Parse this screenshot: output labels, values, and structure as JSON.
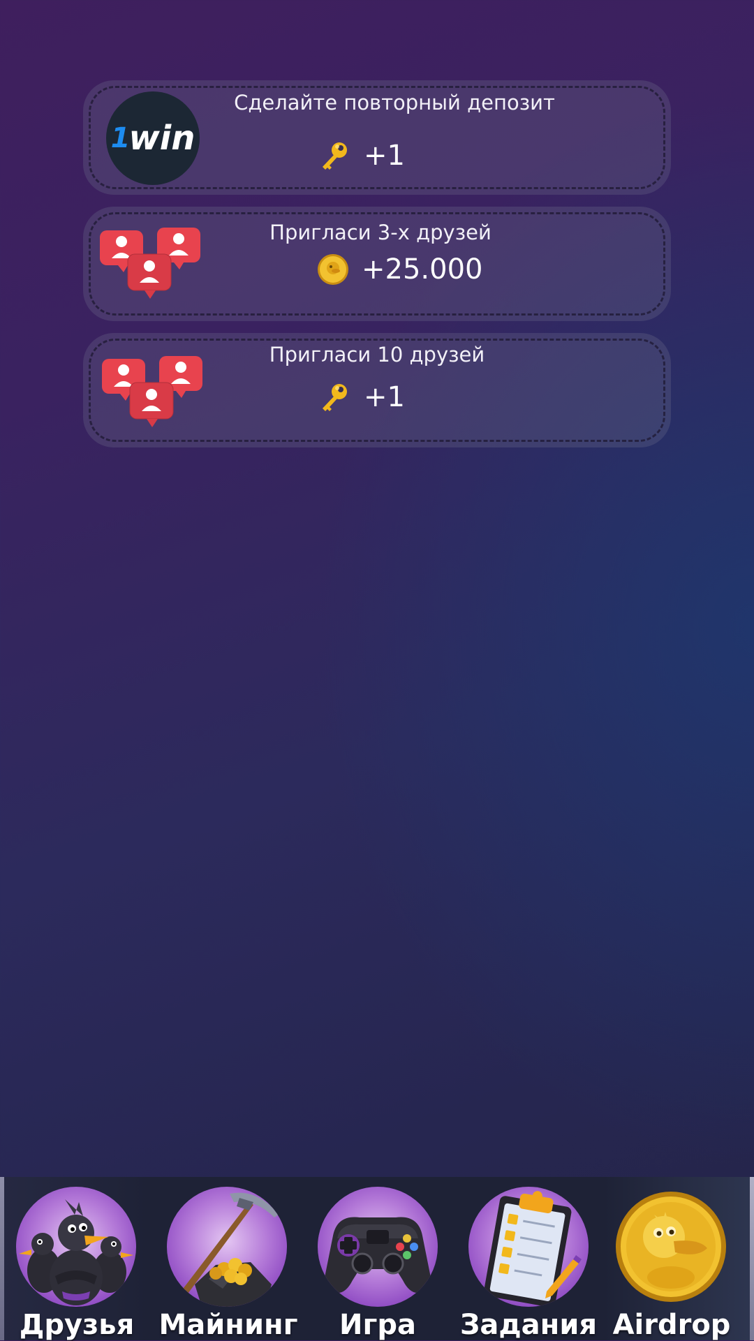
{
  "tasks": [
    {
      "title": "Сделайте повторный депозит",
      "reward_icon": "key-icon",
      "reward_value": "+1",
      "logo_text": "1win",
      "logo_one": "1",
      "logo_win": "win"
    },
    {
      "title": "Пригласи 3-х друзей",
      "reward_icon": "duck-coin-icon",
      "reward_value": "+25.000"
    },
    {
      "title": "Пригласи 10 друзей",
      "reward_icon": "key-icon",
      "reward_value": "+1"
    }
  ],
  "nav": {
    "items": [
      {
        "label": "Друзья",
        "icon": "ducks-friends-icon"
      },
      {
        "label": "Майнинг",
        "icon": "pickaxe-gold-icon"
      },
      {
        "label": "Игра",
        "icon": "gamepad-icon"
      },
      {
        "label": "Задания",
        "icon": "checklist-clipboard-icon"
      },
      {
        "label": "Airdrop",
        "icon": "duck-coin-icon"
      }
    ]
  },
  "colors": {
    "accent_red": "#e8434e",
    "gold": "#f2b81c",
    "purple": "#a05cd0"
  }
}
